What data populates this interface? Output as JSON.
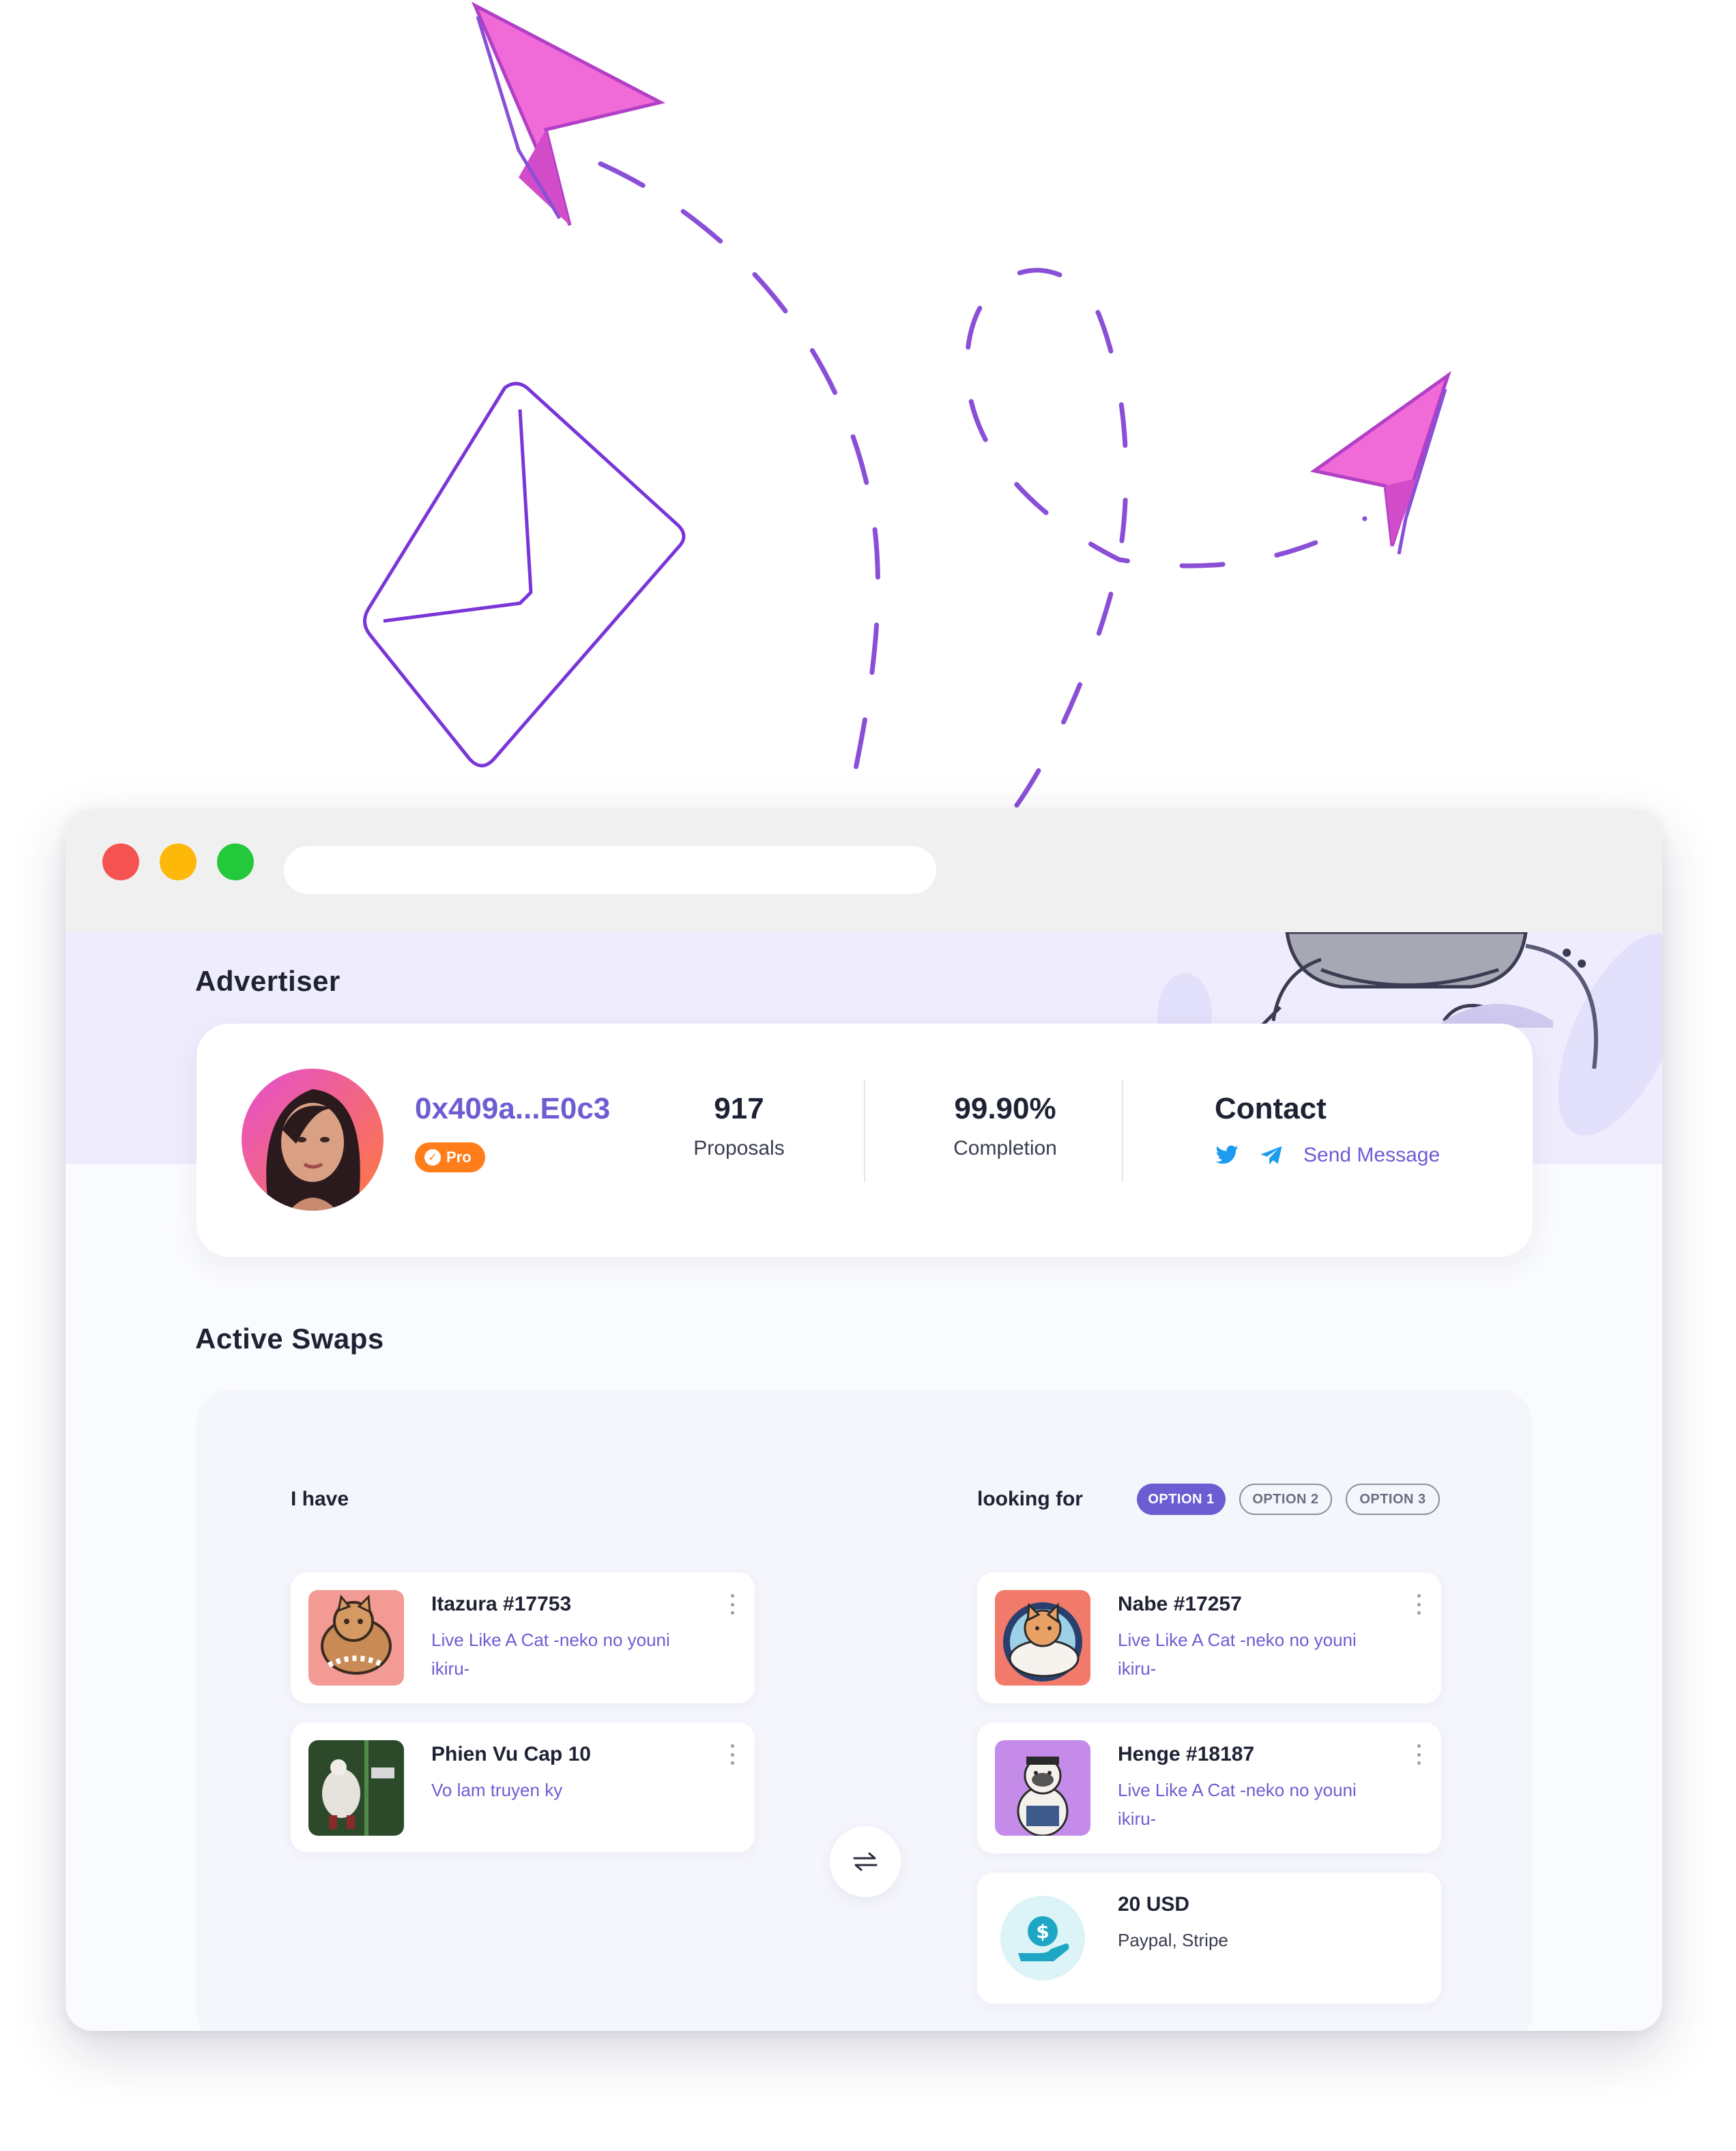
{
  "colors": {
    "accent": "#6c5dd3",
    "pro_badge": "#ff7d1a",
    "banner": "#eeecfd",
    "arrow_pink": "#f06ad8",
    "line_purple": "#8a4fd6"
  },
  "window": {
    "controls": [
      "close",
      "minimize",
      "maximize"
    ],
    "url": ""
  },
  "advertiser": {
    "section_title": "Advertiser",
    "address": "0x409a...E0c3",
    "badge": "Pro",
    "stats": [
      {
        "value": "917",
        "label": "Proposals"
      },
      {
        "value": "99.90%",
        "label": "Completion"
      }
    ],
    "contact": {
      "title": "Contact",
      "icons": [
        "twitter-icon",
        "telegram-icon"
      ],
      "send_message": "Send Message"
    }
  },
  "swaps": {
    "section_title": "Active Swaps",
    "have_label": "I have",
    "looking_label": "looking for",
    "options": [
      "OPTION 1",
      "OPTION 2",
      "OPTION 3"
    ],
    "active_option": "OPTION 1",
    "have_items": [
      {
        "name": "Itazura #17753",
        "collection": "Live Like A Cat -neko no youni ikiru-"
      },
      {
        "name": "Phien Vu Cap 10",
        "collection": "Vo lam truyen ky"
      }
    ],
    "looking_items": [
      {
        "name": "Nabe #17257",
        "collection": "Live Like A Cat -neko no youni ikiru-"
      },
      {
        "name": "Henge #18187",
        "collection": "Live Like A Cat -neko no youni ikiru-"
      }
    ],
    "payment": {
      "amount": "20 USD",
      "methods": "Paypal, Stripe",
      "icon": "dollar-hand-icon"
    }
  }
}
